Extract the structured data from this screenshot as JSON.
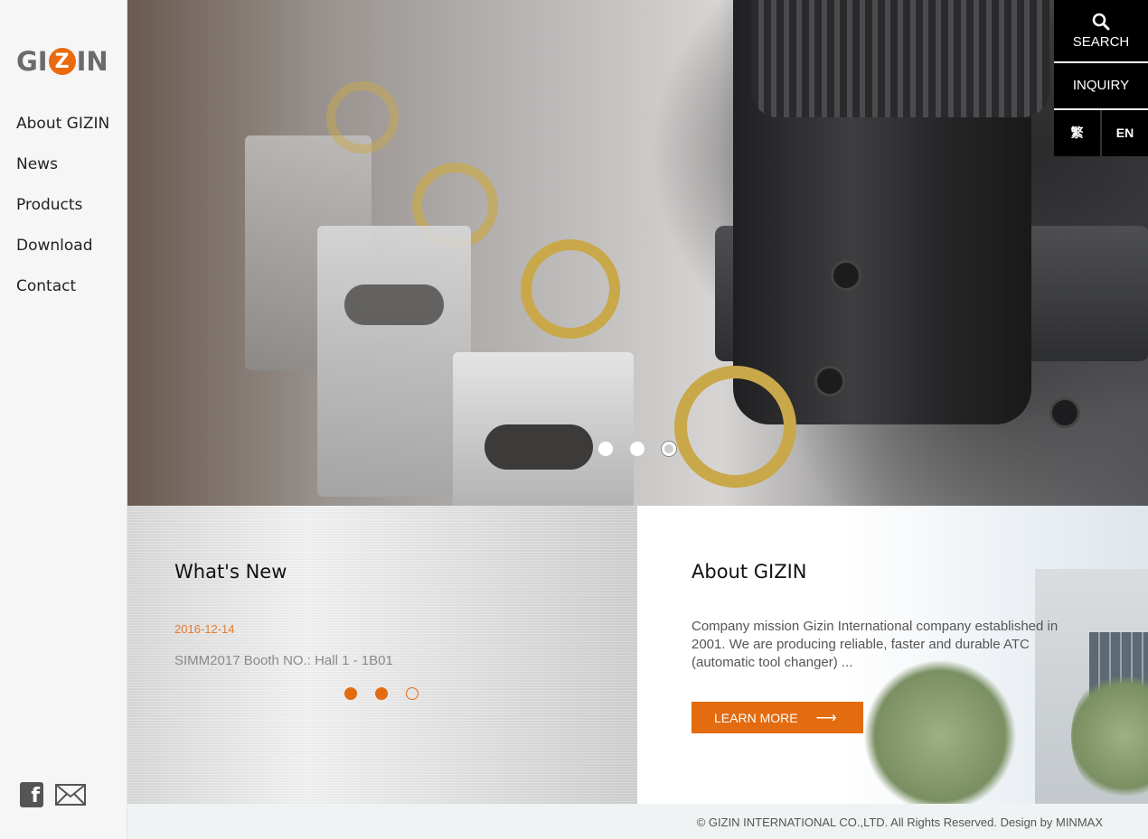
{
  "brand": {
    "name_left": "GI",
    "name_mid": "Z",
    "name_right": "IN",
    "accent_color": "#e36b10"
  },
  "sidebar": {
    "items": [
      {
        "label": "About GIZIN"
      },
      {
        "label": "News"
      },
      {
        "label": "Products"
      },
      {
        "label": "Download"
      },
      {
        "label": "Contact"
      }
    ],
    "social": {
      "facebook_glyph": "f",
      "facebook_icon": "facebook-icon",
      "mail_icon": "mail-icon"
    }
  },
  "header": {
    "search_label": "SEARCH",
    "inquiry_label": "INQUIRY",
    "lang_tc": "繁",
    "lang_en": "EN"
  },
  "hero": {
    "slide_count": 3,
    "active_slide": 3
  },
  "news": {
    "title": "What's New",
    "date": "2016-12-14",
    "headline": "SIMM2017 Booth NO.: Hall 1 - 1B01",
    "slide_count": 3,
    "active_slide": 3
  },
  "about": {
    "title": "About GIZIN",
    "text": "Company mission Gizin International company established in 2001. We are producing reliable, faster and durable ATC (automatic tool changer) ...",
    "button_label": "LEARN MORE",
    "button_arrow": "⟶"
  },
  "footer": {
    "copyright": "© GIZIN INTERNATIONAL CO.,LTD. All Rights Reserved. Design by MINMAX"
  }
}
